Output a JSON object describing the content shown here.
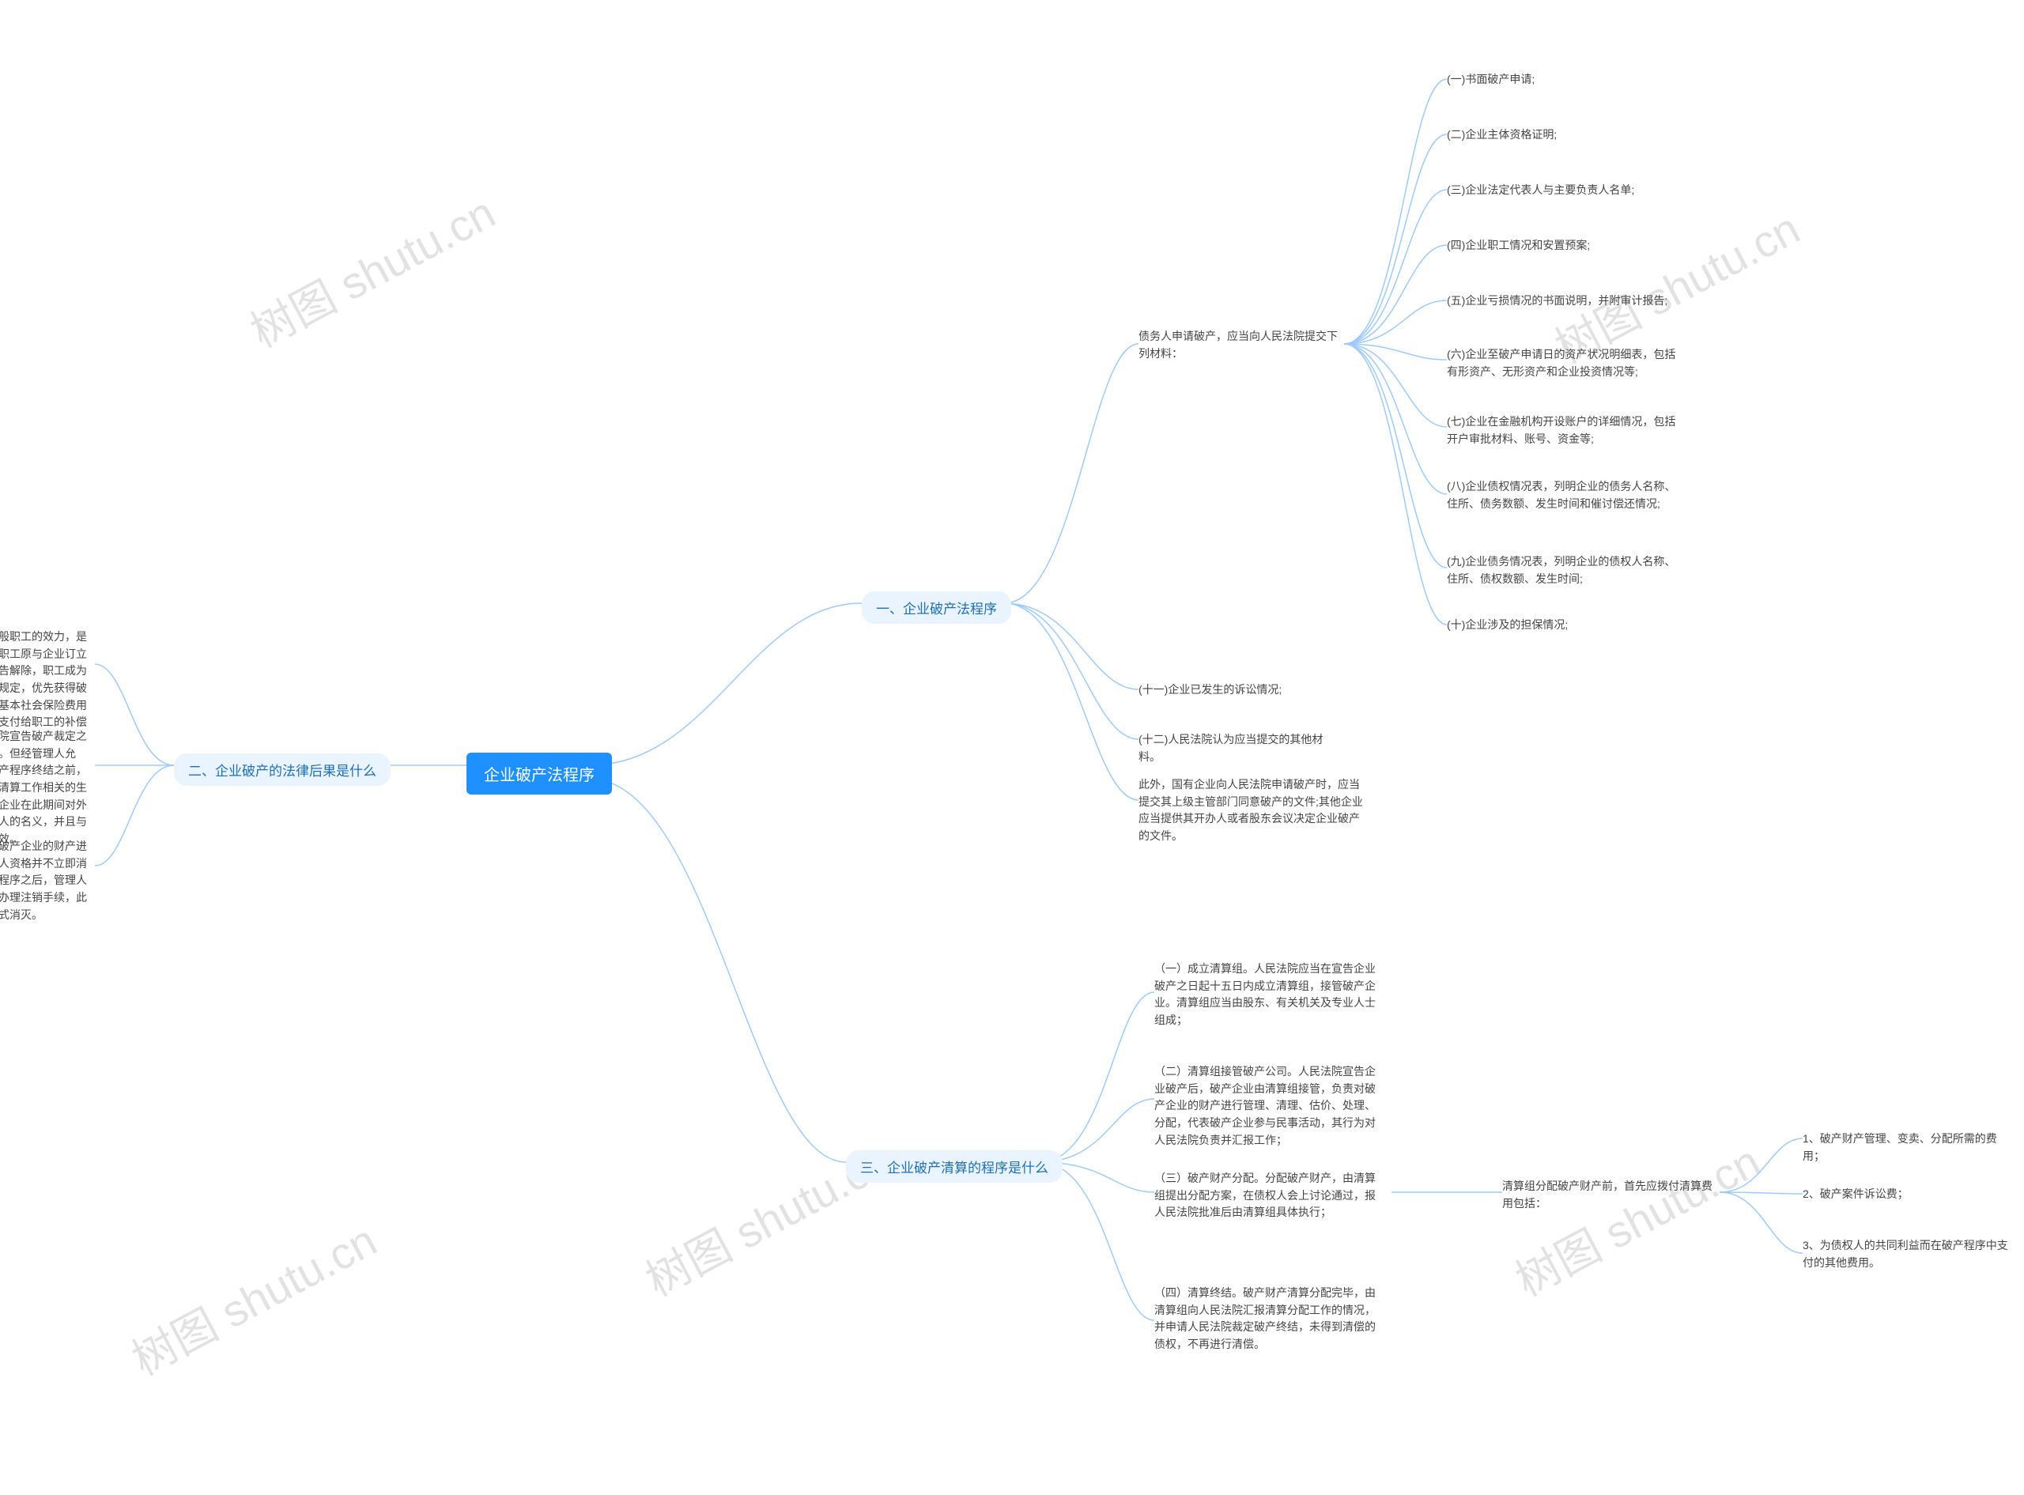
{
  "center": "企业破产法程序",
  "watermark": "树图 shutu.cn",
  "branch1": {
    "title": "一、企业破产法程序",
    "sub1": "债务人申请破产，应当向人民法院提交下列材料：",
    "s1_items": [
      "(一)书面破产申请;",
      "(二)企业主体资格证明;",
      "(三)企业法定代表人与主要负责人名单;",
      "(四)企业职工情况和安置预案;",
      "(五)企业亏损情况的书面说明，并附审计报告;",
      "(六)企业至破产申请日的资产状况明细表，包括有形资产、无形资产和企业投资情况等;",
      "(七)企业在金融机构开设账户的详细情况，包括开户审批材料、账号、资金等;",
      "(八)企业债权情况表，列明企业的债务人名称、住所、债务数额、发生时间和催讨偿还情况;",
      "(九)企业债务情况表，列明企业的债权人名称、住所、债权数额、发生时间;",
      "(十)企业涉及的担保情况;"
    ],
    "sub2": "(十一)企业已发生的诉讼情况;",
    "sub3": "(十二)人民法院认为应当提交的其他材料。",
    "sub4": "此外，国有企业向人民法院申请破产时，应当提交其上级主管部门同意破产的文件;其他企业应当提供其开办人或者股东会议决定企业破产的文件。"
  },
  "branch2": {
    "title": "二、企业破产的法律后果是什么",
    "items": [
      "破产宣告对破产企业一般职工的效力，是指企业被宣告破产后，职工原与企业订立的劳动合同即可依法宣告解除，职工成为失业人员，有权依据的规定，优先获得破产人所欠职工的工资和基本社会保险费用以及法律法规规定应该支付给职工的补偿金后重新自主就业。",
      "破产企业应当自人民法院宣告破产裁定之日起停止生产经营活动。但经管理人允许，破产企业可以在破产程序终结之前，以管理人的名义从事与清算工作相关的生产经营活动。如果破产企业在此期间对外签订合同，并非以管理人的名义，并且与清算无关，应当认定无效。",
      "破产宣告后，管理人对破产企业的财产进行变价分配，企业的法人资格并不立即消灭，只有法院终结破产程序之后，管理人向破产人的原登记机关办理注销手续，此时企业的法人资格才正式消灭。"
    ]
  },
  "branch3": {
    "title": "三、企业破产清算的程序是什么",
    "items": [
      "（一）成立清算组。人民法院应当在宣告企业破产之日起十五日内成立清算组，接管破产企业。清算组应当由股东、有关机关及专业人士组成；",
      "（二）清算组接管破产公司。人民法院宣告企业破产后，破产企业由清算组接管，负责对破产企业的财产进行管理、清理、估价、处理、分配，代表破产企业参与民事活动，其行为对人民法院负责并汇报工作；",
      "（三）破产财产分配。分配破产财产，由清算组提出分配方案，在债权人会上讨论通过，报人民法院批准后由清算组具体执行；",
      "（四）清算终结。破产财产清算分配完毕，由清算组向人民法院汇报清算分配工作的情况，并申请人民法院裁定破产终结，未得到清偿的债权，不再进行清偿。"
    ],
    "sub3_head": "清算组分配破产财产前，首先应拨付清算费用包括：",
    "sub3_items": [
      "1、破产财产管理、变卖、分配所需的费用；",
      "2、破产案件诉讼费；",
      "3、为债权人的共同利益而在破产程序中支付的其他费用。"
    ]
  }
}
